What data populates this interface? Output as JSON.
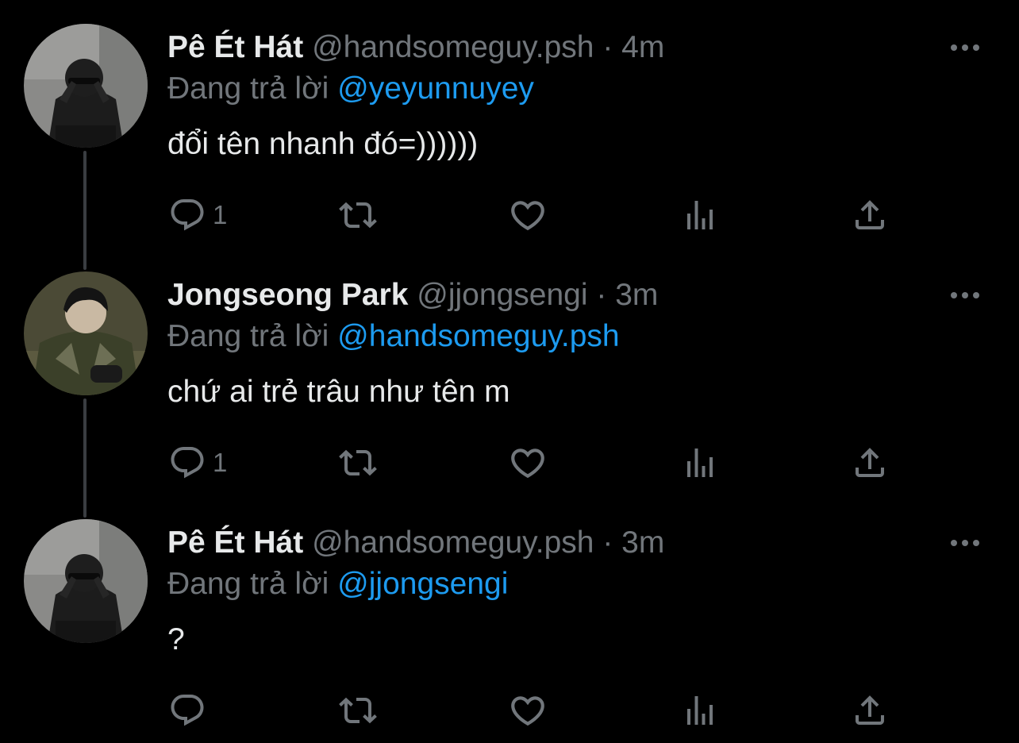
{
  "colors": {
    "background": "#000000",
    "primary_text": "#e7e9ea",
    "secondary_text": "#71767b",
    "mention": "#1d9bf0",
    "thread_line": "#3a3d41"
  },
  "reply_prefix": "Đang trả lời",
  "tweets": [
    {
      "display_name": "Pê Ét Hát",
      "handle": "@handsomeguy.psh",
      "separator": "·",
      "time": "4m",
      "replying_to": "@yeyunnuyey",
      "text": "đổi tên nhanh đó=))))))",
      "reply_count": "1",
      "avatar": "photo-man-dark-outfit-sunglasses"
    },
    {
      "display_name": "Jongseong Park",
      "handle": "@jjongsengi",
      "separator": "·",
      "time": "3m",
      "replying_to": "@handsomeguy.psh",
      "text": "chứ ai trẻ trâu như tên m",
      "reply_count": "1",
      "avatar": "photo-man-green-jacket"
    },
    {
      "display_name": "Pê Ét Hát",
      "handle": "@handsomeguy.psh",
      "separator": "·",
      "time": "3m",
      "replying_to": "@jjongsengi",
      "text": "?",
      "reply_count": "",
      "avatar": "photo-man-dark-outfit-sunglasses"
    }
  ],
  "icons": {
    "more": "more-dots-icon",
    "reply": "reply-bubble-icon",
    "retweet": "retweet-icon",
    "like": "heart-icon",
    "stats": "analytics-icon",
    "share": "share-icon"
  }
}
